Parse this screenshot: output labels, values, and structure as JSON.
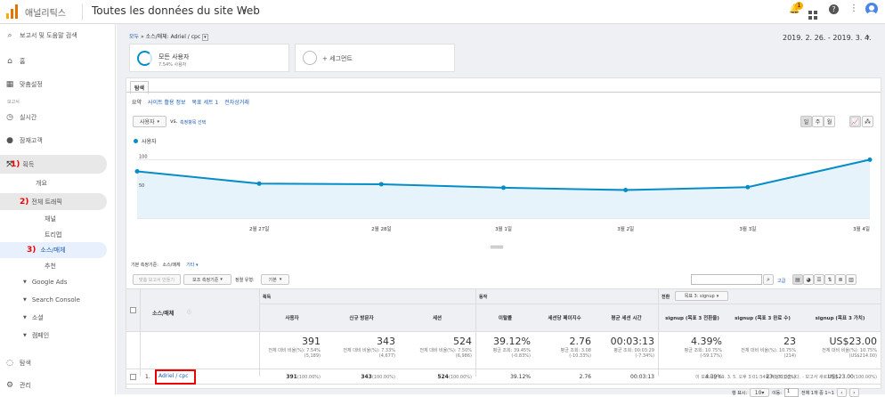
{
  "topbar": {
    "logo_text": "애널리틱스",
    "view_title": "Toutes les données du site Web",
    "notification_count": "1"
  },
  "sidebar": {
    "search": "보고서 및 도움말 검색",
    "home": "홈",
    "custom": "맞춤설정",
    "section": "보고서",
    "realtime": "실시간",
    "audience": "잠재고객",
    "acquisition": "획득",
    "overview": "개요",
    "all_traffic": "전체 트래픽",
    "channels": "채널",
    "treemap": "트리맵",
    "source_medium": "소스/매체",
    "referrals": "추천",
    "google_ads": "Google Ads",
    "search_console": "Search Console",
    "social": "소셜",
    "campaigns": "캠페인",
    "discover": "탐색",
    "admin": "관리",
    "annotations": [
      "1)",
      "2)",
      "3)"
    ]
  },
  "header": {
    "breadcrumb_all": "모두",
    "breadcrumb_sep": "»",
    "breadcrumb_path": "소스/매체: Adriel / cpc",
    "date_range": "2019. 2. 26. - 2019. 3. 4."
  },
  "segments": {
    "active_title": "모든 사용자",
    "active_sub": "7.54% 사용자",
    "add_segment": "+ 세그먼트"
  },
  "tabs": {
    "explorer": "탐색",
    "subtabs": [
      "요약",
      "사이트 활용 정보",
      "목표 세트 1",
      "전자상거래"
    ]
  },
  "chart_controls": {
    "metric": "사용자",
    "vs": "vs.",
    "select_metric": "측정항목 선택",
    "granularity": [
      "일",
      "주",
      "월"
    ]
  },
  "chart_data": {
    "type": "line",
    "series": [
      {
        "name": "사용자",
        "values": [
          80,
          59,
          58,
          52,
          48,
          53,
          100
        ]
      }
    ],
    "categories": [
      "",
      "2월 27일",
      "2월 28일",
      "3월 1일",
      "3월 2일",
      "3월 3일",
      "3월 4일"
    ],
    "y_ticks": [
      "100",
      "50"
    ],
    "ylim": [
      0,
      125
    ],
    "color": "#058dc7"
  },
  "dimension_bar": {
    "label": "기본 측정기준:",
    "current": "소스/매체",
    "other": "기타"
  },
  "table_controls": {
    "secondary": "보조 측정기준",
    "sort_label": "정렬 유형:",
    "sort_value": "기본",
    "advanced": "고급",
    "conversion_label": "전환",
    "conversion_value": "목표 3: signup",
    "create_report": "맞춤 보고서 만들기"
  },
  "table": {
    "groups": {
      "acquisition": "획득",
      "behavior": "동작"
    },
    "dimension_header": "소스/매체",
    "columns": [
      "사용자",
      "신규 방문자",
      "세션",
      "이탈률",
      "세션당 페이지수",
      "평균 세션 시간",
      "signup (목표 3 전환율)",
      "signup (목표 3 완료 수)",
      "signup (목표 3 가치)"
    ],
    "totals": [
      "391",
      "343",
      "524",
      "39.12%",
      "2.76",
      "00:03:13",
      "4.39%",
      "23",
      "US$23.00"
    ],
    "totals_sub_a": [
      "전체 대비 비율(%): 7.54%",
      "전체 대비 비율(%): 7.33%",
      "전체 대비 비율(%): 7.50%",
      "평균 조회: 39.45%",
      "평균 조회: 3.08",
      "평균 조회: 00:03:29",
      "평균 조회: 10.75%",
      "전체 대비 비율(%): 10.75%",
      "전체 대비 비율(%): 10.75%"
    ],
    "totals_sub_b": [
      "(5,189)",
      "(4,677)",
      "(6,986)",
      "(-0.83%)",
      "(-10.33%)",
      "(-7.34%)",
      "(-59.17%)",
      "(214)",
      "(US$214.00)"
    ],
    "row": {
      "index": "1.",
      "dimension": "Adriel / cpc",
      "values": [
        "391",
        "343",
        "524",
        "39.12%",
        "2.76",
        "00:03:13",
        "4.39%",
        "23",
        "US$23.00"
      ],
      "pcts": [
        "(100.00%)",
        "(100.00%)",
        "(100.00%)",
        "",
        "",
        "",
        "",
        "(100.00%)",
        "(100.00%)"
      ]
    }
  },
  "pagination": {
    "rows_label": "행 표시:",
    "rows_value": "10",
    "goto_label": "이동:",
    "goto_value": "1",
    "range": "전체 1개 중 1~1"
  },
  "footer_note": "이 보고서는 19. 3. 5. 오후 3:01:34에 작성되었습니다. - 보고서 새로고침"
}
